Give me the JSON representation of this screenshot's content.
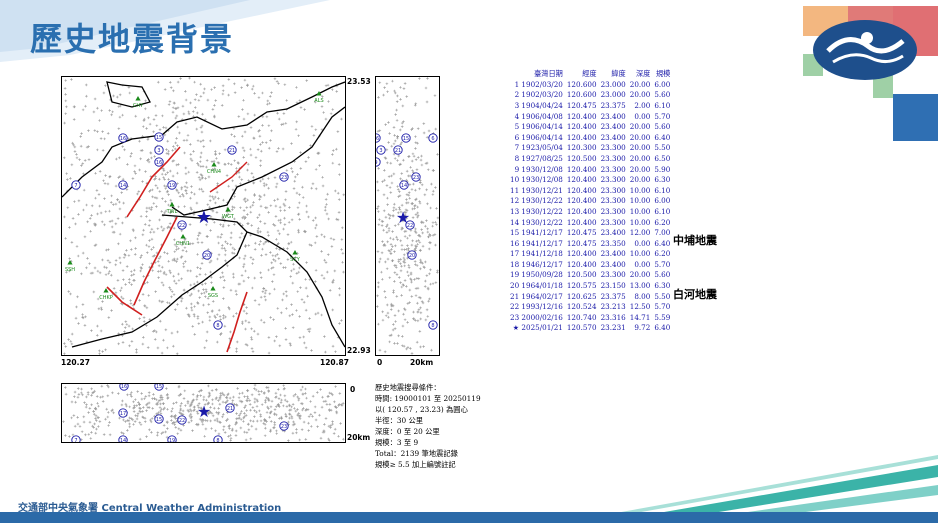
{
  "slide": {
    "title": "歷史地震背景",
    "footer": "交通部中央氣象署 Central Weather Administration"
  },
  "map": {
    "lat_top": "23.53",
    "lat_bottom": "22.93",
    "lon_left": "120.27",
    "lon_right": "120.87",
    "depth_top_label": "0",
    "depth_bottom_label": "20km",
    "side_scale_left": "0",
    "side_scale_right": "20km",
    "stations": [
      "CHY",
      "ALS",
      "CHN4",
      "TWL",
      "WGT",
      "CHN1",
      "SSH",
      "SCY",
      "CHKP",
      "SGS"
    ],
    "main_event_marker": "★"
  },
  "table": {
    "headers": [
      "臺灣日期",
      "經度",
      "緯度",
      "深度",
      "規模"
    ],
    "rows": [
      {
        "n": "1",
        "date": "1902/03/20",
        "lon": "120.600",
        "lat": "23.000",
        "dep": "20.00",
        "mag": "6.00"
      },
      {
        "n": "2",
        "date": "1902/03/20",
        "lon": "120.600",
        "lat": "23.000",
        "dep": "20.00",
        "mag": "5.60"
      },
      {
        "n": "3",
        "date": "1904/04/24",
        "lon": "120.475",
        "lat": "23.375",
        "dep": "2.00",
        "mag": "6.10"
      },
      {
        "n": "4",
        "date": "1906/04/08",
        "lon": "120.400",
        "lat": "23.400",
        "dep": "0.00",
        "mag": "5.70"
      },
      {
        "n": "5",
        "date": "1906/04/14",
        "lon": "120.400",
        "lat": "23.400",
        "dep": "20.00",
        "mag": "5.60"
      },
      {
        "n": "6",
        "date": "1906/04/14",
        "lon": "120.400",
        "lat": "23.400",
        "dep": "20.00",
        "mag": "6.40"
      },
      {
        "n": "7",
        "date": "1923/05/04",
        "lon": "120.300",
        "lat": "23.300",
        "dep": "20.00",
        "mag": "5.50"
      },
      {
        "n": "8",
        "date": "1927/08/25",
        "lon": "120.500",
        "lat": "23.300",
        "dep": "20.00",
        "mag": "6.50"
      },
      {
        "n": "9",
        "date": "1930/12/08",
        "lon": "120.400",
        "lat": "23.300",
        "dep": "20.00",
        "mag": "5.90"
      },
      {
        "n": "10",
        "date": "1930/12/08",
        "lon": "120.400",
        "lat": "23.300",
        "dep": "20.00",
        "mag": "6.30"
      },
      {
        "n": "11",
        "date": "1930/12/21",
        "lon": "120.400",
        "lat": "23.300",
        "dep": "10.00",
        "mag": "6.10"
      },
      {
        "n": "12",
        "date": "1930/12/22",
        "lon": "120.400",
        "lat": "23.300",
        "dep": "10.00",
        "mag": "6.00"
      },
      {
        "n": "13",
        "date": "1930/12/22",
        "lon": "120.400",
        "lat": "23.300",
        "dep": "10.00",
        "mag": "6.10"
      },
      {
        "n": "14",
        "date": "1930/12/22",
        "lon": "120.400",
        "lat": "23.300",
        "dep": "10.00",
        "mag": "6.20"
      },
      {
        "n": "15",
        "date": "1941/12/17",
        "lon": "120.475",
        "lat": "23.400",
        "dep": "12.00",
        "mag": "7.00"
      },
      {
        "n": "16",
        "date": "1941/12/17",
        "lon": "120.475",
        "lat": "23.350",
        "dep": "0.00",
        "mag": "6.40"
      },
      {
        "n": "17",
        "date": "1941/12/18",
        "lon": "120.400",
        "lat": "23.400",
        "dep": "10.00",
        "mag": "6.20"
      },
      {
        "n": "18",
        "date": "1946/12/17",
        "lon": "120.400",
        "lat": "23.400",
        "dep": "0.00",
        "mag": "5.70"
      },
      {
        "n": "19",
        "date": "1950/09/28",
        "lon": "120.500",
        "lat": "23.300",
        "dep": "20.00",
        "mag": "5.60"
      },
      {
        "n": "20",
        "date": "1964/01/18",
        "lon": "120.575",
        "lat": "23.150",
        "dep": "13.00",
        "mag": "6.30"
      },
      {
        "n": "21",
        "date": "1964/02/17",
        "lon": "120.625",
        "lat": "23.375",
        "dep": "8.00",
        "mag": "5.50"
      },
      {
        "n": "22",
        "date": "1993/12/16",
        "lon": "120.524",
        "lat": "23.213",
        "dep": "12.50",
        "mag": "5.70"
      },
      {
        "n": "23",
        "date": "2000/02/16",
        "lon": "120.740",
        "lat": "23.316",
        "dep": "14.71",
        "mag": "5.59"
      },
      {
        "n": "★",
        "date": "2025/01/21",
        "lon": "120.570",
        "lat": "23.231",
        "dep": "9.72",
        "mag": "6.40"
      }
    ],
    "callout_15": "中埔地震",
    "callout_20": "白河地震"
  },
  "conditions": {
    "heading": "歷史地震搜尋條件：",
    "time": "時間: 19000101 至 20250119",
    "center": "以( 120.57 , 23.23) 為圓心",
    "radius": "半徑：30 公里",
    "depth": "深度：0 至 20 公里",
    "magnitude": "規模：3 至 9",
    "total": "Total：2139 筆地震記錄",
    "note": "規模≥ 5.5 加上編號註記"
  },
  "colors": {
    "title": "#2a6fb0",
    "marker": "#1a1aa8",
    "fault": "#d0201f",
    "station": "#1a8a1a",
    "scatter": "#9a9a9a"
  }
}
